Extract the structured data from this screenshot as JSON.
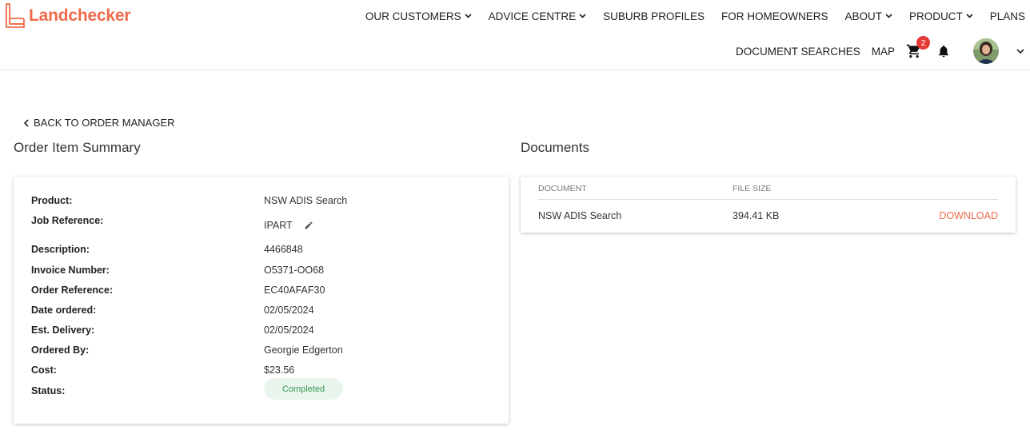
{
  "brand": {
    "name": "Landchecker",
    "color": "#ef6a4b"
  },
  "nav": {
    "primary": [
      {
        "label": "OUR CUSTOMERS",
        "dropdown": true
      },
      {
        "label": "ADVICE CENTRE",
        "dropdown": true
      },
      {
        "label": "SUBURB PROFILES",
        "dropdown": false
      },
      {
        "label": "FOR HOMEOWNERS",
        "dropdown": false
      },
      {
        "label": "ABOUT",
        "dropdown": true
      },
      {
        "label": "PRODUCT",
        "dropdown": true
      },
      {
        "label": "PLANS",
        "dropdown": false
      }
    ],
    "secondary": {
      "document_searches": "DOCUMENT SEARCHES",
      "map": "MAP",
      "cart_count": "2",
      "cart_icon": "cart-icon",
      "bell_icon": "bell-icon"
    }
  },
  "back_link": "BACK TO ORDER MANAGER",
  "summary": {
    "title": "Order Item Summary",
    "fields": {
      "product": {
        "label": "Product:",
        "value": "NSW ADIS Search"
      },
      "job_reference": {
        "label": "Job Reference:",
        "value": "IPART"
      },
      "description": {
        "label": "Description:",
        "value": "4466848"
      },
      "invoice_number": {
        "label": "Invoice Number:",
        "value": "O5371-OO68"
      },
      "order_reference": {
        "label": "Order Reference:",
        "value": "EC40AFAF30"
      },
      "date_ordered": {
        "label": "Date ordered:",
        "value": "02/05/2024"
      },
      "est_delivery": {
        "label": "Est. Delivery:",
        "value": "02/05/2024"
      },
      "ordered_by": {
        "label": "Ordered By:",
        "value": "Georgie Edgerton"
      },
      "cost": {
        "label": "Cost:",
        "value": "$23.56"
      },
      "status": {
        "label": "Status:",
        "value": "Completed",
        "color": "#3a9a57"
      }
    }
  },
  "documents": {
    "title": "Documents",
    "columns": {
      "document": "DOCUMENT",
      "file_size": "FILE SIZE"
    },
    "rows": [
      {
        "document": "NSW ADIS Search",
        "file_size": "394.41 KB",
        "action": "DOWNLOAD"
      }
    ]
  }
}
